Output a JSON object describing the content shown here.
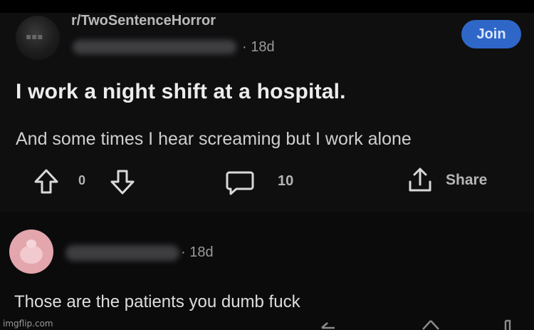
{
  "post": {
    "subreddit": "r/TwoSentenceHorror",
    "time": "· 18d",
    "join_label": "Join",
    "title": "I work a night shift at a hospital.",
    "body": "And some times I hear screaming but I work alone",
    "vote_count": "0",
    "comment_count": "10",
    "share_label": "Share",
    "icons": {
      "subreddit": "subreddit-avatar",
      "upvote": "upvote-arrow-icon",
      "downvote": "downvote-arrow-icon",
      "comments": "comment-bubble-icon",
      "share": "share-icon"
    }
  },
  "comment": {
    "time": "· 18d",
    "text": "Those are the patients you dumb fuck"
  },
  "watermark": "imgflip.com",
  "colors": {
    "background": "#0b0b0c",
    "join_button": "#2f67c9",
    "avatar": "#e3a6ad"
  }
}
